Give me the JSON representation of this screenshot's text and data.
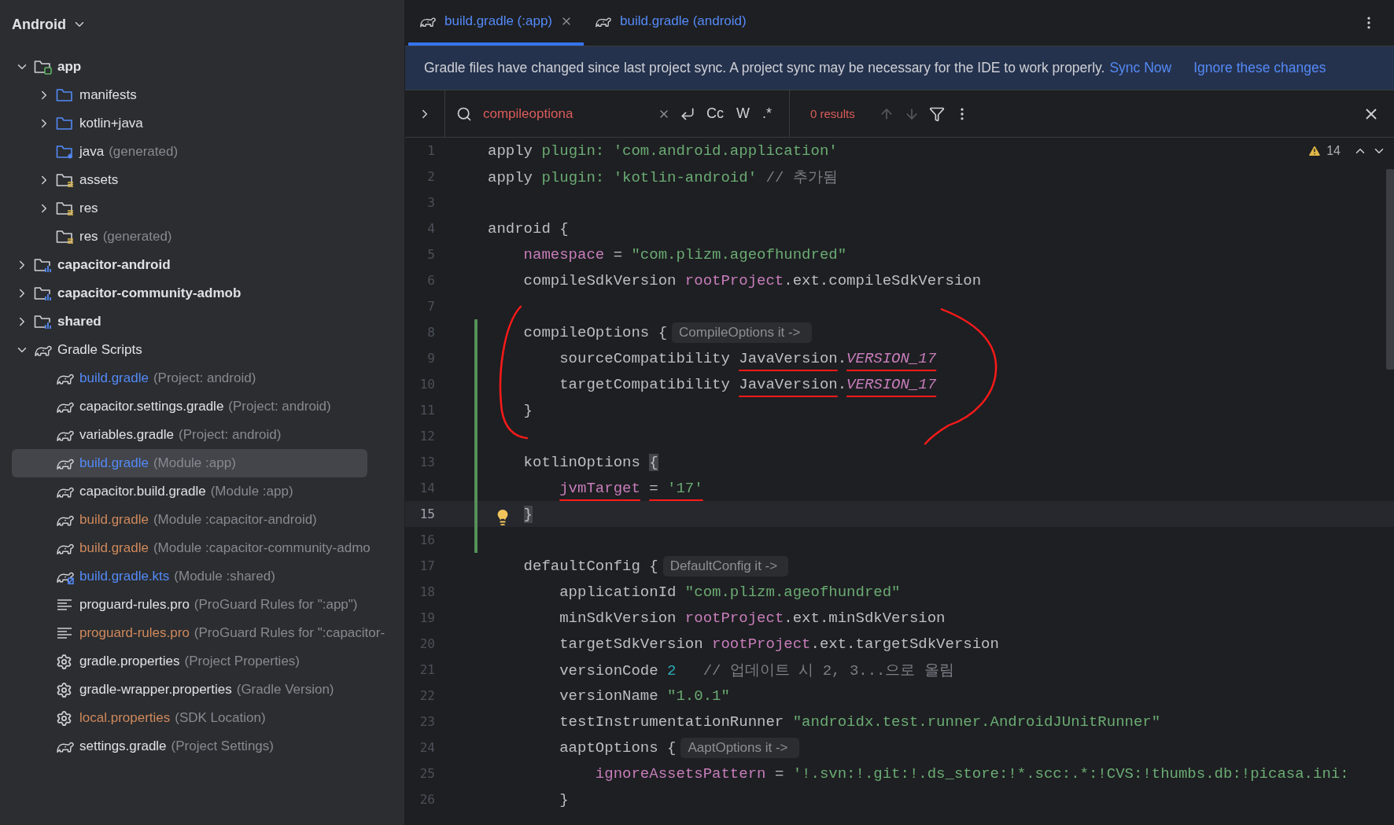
{
  "project_view": {
    "title": "Android"
  },
  "tree": [
    {
      "label": "app",
      "kind": "module-app",
      "expanded": true,
      "selected": false,
      "children": [
        {
          "label": "manifests",
          "kind": "folder",
          "expanded": false,
          "selected": false
        },
        {
          "label": "kotlin+java",
          "kind": "folder",
          "expanded": false,
          "selected": false
        },
        {
          "label": "java",
          "note": "(generated)",
          "kind": "folder-generated",
          "selected": false
        },
        {
          "label": "assets",
          "kind": "folder-res",
          "expanded": false,
          "selected": false
        },
        {
          "label": "res",
          "kind": "folder-res",
          "expanded": false,
          "selected": false
        },
        {
          "label": "res",
          "note": "(generated)",
          "kind": "folder-res",
          "selected": false
        }
      ]
    },
    {
      "label": "capacitor-android",
      "kind": "module-lib",
      "expanded": false,
      "selected": false
    },
    {
      "label": "capacitor-community-admob",
      "kind": "module-lib",
      "expanded": false,
      "selected": false
    },
    {
      "label": "shared",
      "kind": "module-lib",
      "expanded": false,
      "selected": false
    },
    {
      "label": "Gradle Scripts",
      "kind": "gradle-group",
      "expanded": true,
      "selected": false,
      "children": [
        {
          "label": "build.gradle",
          "note": "(Project: android)",
          "kind": "gradle",
          "color": "#548af7",
          "selected": false
        },
        {
          "label": "capacitor.settings.gradle",
          "note": "(Project: android)",
          "kind": "gradle",
          "color": "#dfe1e5",
          "selected": false
        },
        {
          "label": "variables.gradle",
          "note": "(Project: android)",
          "kind": "gradle",
          "color": "#dfe1e5",
          "selected": false
        },
        {
          "label": "build.gradle",
          "note": "(Module :app)",
          "kind": "gradle",
          "color": "#548af7",
          "selected": true
        },
        {
          "label": "capacitor.build.gradle",
          "note": "(Module :app)",
          "kind": "gradle",
          "color": "#dfe1e5",
          "selected": false
        },
        {
          "label": "build.gradle",
          "note": "(Module :capacitor-android)",
          "kind": "gradle",
          "color": "#d0895c",
          "selected": false
        },
        {
          "label": "build.gradle",
          "note": "(Module :capacitor-community-admo",
          "kind": "gradle",
          "color": "#d0895c",
          "selected": false
        },
        {
          "label": "build.gradle.kts",
          "note": "(Module :shared)",
          "kind": "gradle-kts",
          "color": "#548af7",
          "selected": false
        },
        {
          "label": "proguard-rules.pro",
          "note": "(ProGuard Rules for \":app\")",
          "kind": "text",
          "color": "#dfe1e5",
          "selected": false
        },
        {
          "label": "proguard-rules.pro",
          "note": "(ProGuard Rules for \":capacitor-",
          "kind": "text",
          "color": "#d0895c",
          "selected": false
        },
        {
          "label": "gradle.properties",
          "note": "(Project Properties)",
          "kind": "properties",
          "color": "#dfe1e5",
          "selected": false
        },
        {
          "label": "gradle-wrapper.properties",
          "note": "(Gradle Version)",
          "kind": "properties",
          "color": "#dfe1e5",
          "selected": false
        },
        {
          "label": "local.properties",
          "note": "(SDK Location)",
          "kind": "properties",
          "color": "#d0895c",
          "selected": false
        },
        {
          "label": "settings.gradle",
          "note": "(Project Settings)",
          "kind": "gradle",
          "color": "#dfe1e5",
          "selected": false
        }
      ]
    }
  ],
  "tabs": [
    {
      "label": "build.gradle (:app)",
      "selected": true,
      "closable": true
    },
    {
      "label": "build.gradle (android)",
      "selected": false,
      "closable": false
    }
  ],
  "banner": {
    "message": "Gradle files have changed since last project sync. A project sync may be necessary for the IDE to work properly.",
    "actions": [
      "Sync Now",
      "Ignore these changes"
    ]
  },
  "search": {
    "value": "compileoptiona",
    "toggles": [
      "Cc",
      "W",
      ".*"
    ],
    "results": "0 results"
  },
  "editor": {
    "warnings": "14",
    "lines": [
      {
        "number": "1",
        "changed": false,
        "current": false,
        "circled": false,
        "tokens": [
          {
            "text": "apply ",
            "kind": "plain"
          },
          {
            "text": "plugin: 'com.android.application'",
            "kind": "string"
          }
        ]
      },
      {
        "number": "2",
        "changed": false,
        "current": false,
        "circled": false,
        "tokens": [
          {
            "text": "apply ",
            "kind": "plain"
          },
          {
            "text": "plugin: 'kotlin-android'",
            "kind": "string"
          },
          {
            "text": " // 추가됨",
            "kind": "comment"
          }
        ]
      },
      {
        "number": "3",
        "changed": false,
        "current": false,
        "circled": false
      },
      {
        "number": "4",
        "changed": false,
        "current": false,
        "circled": false,
        "tokens": [
          {
            "text": "android {",
            "kind": "plain"
          }
        ]
      },
      {
        "number": "5",
        "changed": false,
        "current": false,
        "circled": false,
        "tokens": [
          {
            "text": "    namespace",
            "kind": "prop"
          },
          {
            "text": " = ",
            "kind": "plain"
          },
          {
            "text": "\"com.plizm.ageofhundred\"",
            "kind": "string"
          }
        ]
      },
      {
        "number": "6",
        "changed": false,
        "current": false,
        "circled": false,
        "tokens": [
          {
            "text": "    compileSdkVersion ",
            "kind": "plain"
          },
          {
            "text": "rootProject",
            "kind": "prop"
          },
          {
            "text": ".ext.compileSdkVersion",
            "kind": "plain"
          }
        ]
      },
      {
        "number": "7",
        "changed": false,
        "current": false,
        "circled": false
      },
      {
        "number": "8",
        "changed": true,
        "current": false,
        "circled": true,
        "tokens": [
          {
            "text": "    compileOptions {",
            "kind": "plain"
          }
        ],
        "hint": "CompileOptions it ->"
      },
      {
        "number": "9",
        "changed": true,
        "current": false,
        "circled": true,
        "tokens": [
          {
            "text": "        sourceCompatibility ",
            "kind": "plain"
          },
          {
            "text": "JavaVersion",
            "kind": "plain",
            "underlined": true
          },
          {
            "text": ".",
            "kind": "plain"
          },
          {
            "text": "VERSION_17",
            "kind": "field",
            "underlined": true
          }
        ]
      },
      {
        "number": "10",
        "changed": true,
        "current": false,
        "circled": true,
        "tokens": [
          {
            "text": "        targetCompatibility ",
            "kind": "plain"
          },
          {
            "text": "JavaVersion",
            "kind": "plain",
            "underlined": true
          },
          {
            "text": ".",
            "kind": "plain"
          },
          {
            "text": "VERSION_17",
            "kind": "field",
            "underlined": true
          }
        ]
      },
      {
        "number": "11",
        "changed": true,
        "current": false,
        "circled": true,
        "tokens": [
          {
            "text": "    }",
            "kind": "plain"
          }
        ]
      },
      {
        "number": "12",
        "changed": true,
        "current": false,
        "circled": false
      },
      {
        "number": "13",
        "changed": true,
        "current": false,
        "circled": false,
        "tokens": [
          {
            "text": "    kotlinOptions ",
            "kind": "plain"
          },
          {
            "text": "{",
            "kind": "brace"
          }
        ]
      },
      {
        "number": "14",
        "changed": true,
        "current": false,
        "circled": false,
        "tokens": [
          {
            "text": "        jvmTarget",
            "kind": "prop",
            "underlined": true
          },
          {
            "text": " = ",
            "kind": "plain",
            "underlined": true
          },
          {
            "text": "'17'",
            "kind": "string",
            "underlined": true
          }
        ]
      },
      {
        "number": "15",
        "changed": true,
        "current": true,
        "circled": false,
        "tokens": [
          {
            "text": "    }",
            "kind": "brace"
          }
        ]
      },
      {
        "number": "16",
        "changed": true,
        "current": false,
        "circled": false
      },
      {
        "number": "17",
        "changed": false,
        "current": false,
        "circled": false,
        "tokens": [
          {
            "text": "    defaultConfig {",
            "kind": "plain"
          }
        ],
        "hint": "DefaultConfig it ->"
      },
      {
        "number": "18",
        "changed": false,
        "current": false,
        "circled": false,
        "tokens": [
          {
            "text": "        applicationId ",
            "kind": "plain"
          },
          {
            "text": "\"com.plizm.ageofhundred\"",
            "kind": "string"
          }
        ]
      },
      {
        "number": "19",
        "changed": false,
        "current": false,
        "circled": false,
        "tokens": [
          {
            "text": "        minSdkVersion ",
            "kind": "plain"
          },
          {
            "text": "rootProject",
            "kind": "prop"
          },
          {
            "text": ".ext.minSdkVersion",
            "kind": "plain"
          }
        ]
      },
      {
        "number": "20",
        "changed": false,
        "current": false,
        "circled": false,
        "tokens": [
          {
            "text": "        targetSdkVersion ",
            "kind": "plain"
          },
          {
            "text": "rootProject",
            "kind": "prop"
          },
          {
            "text": ".ext.targetSdkVersion",
            "kind": "plain"
          }
        ]
      },
      {
        "number": "21",
        "changed": false,
        "current": false,
        "circled": false,
        "tokens": [
          {
            "text": "        versionCode ",
            "kind": "plain"
          },
          {
            "text": "2",
            "kind": "number"
          },
          {
            "text": "   // 업데이트 시 2, 3...으로 올림",
            "kind": "comment"
          }
        ]
      },
      {
        "number": "22",
        "changed": false,
        "current": false,
        "circled": false,
        "tokens": [
          {
            "text": "        versionName ",
            "kind": "plain"
          },
          {
            "text": "\"1.0.1\"",
            "kind": "string"
          }
        ]
      },
      {
        "number": "23",
        "changed": false,
        "current": false,
        "circled": false,
        "tokens": [
          {
            "text": "        testInstrumentationRunner ",
            "kind": "plain"
          },
          {
            "text": "\"androidx.test.runner.AndroidJUnitRunner\"",
            "kind": "string"
          }
        ]
      },
      {
        "number": "24",
        "changed": false,
        "current": false,
        "circled": false,
        "tokens": [
          {
            "text": "        aaptOptions {",
            "kind": "plain"
          }
        ],
        "hint": "AaptOptions it ->"
      },
      {
        "number": "25",
        "changed": false,
        "current": false,
        "circled": false,
        "tokens": [
          {
            "text": "            ignoreAssetsPattern",
            "kind": "prop"
          },
          {
            "text": " = ",
            "kind": "plain"
          },
          {
            "text": "'!.svn:!.git:!.ds_store:!*.scc:.*:!CVS:!thumbs.db:!picasa.ini:",
            "kind": "string"
          }
        ]
      },
      {
        "number": "26",
        "changed": false,
        "current": false,
        "circled": false,
        "tokens": [
          {
            "text": "        }",
            "kind": "plain"
          }
        ]
      }
    ]
  }
}
